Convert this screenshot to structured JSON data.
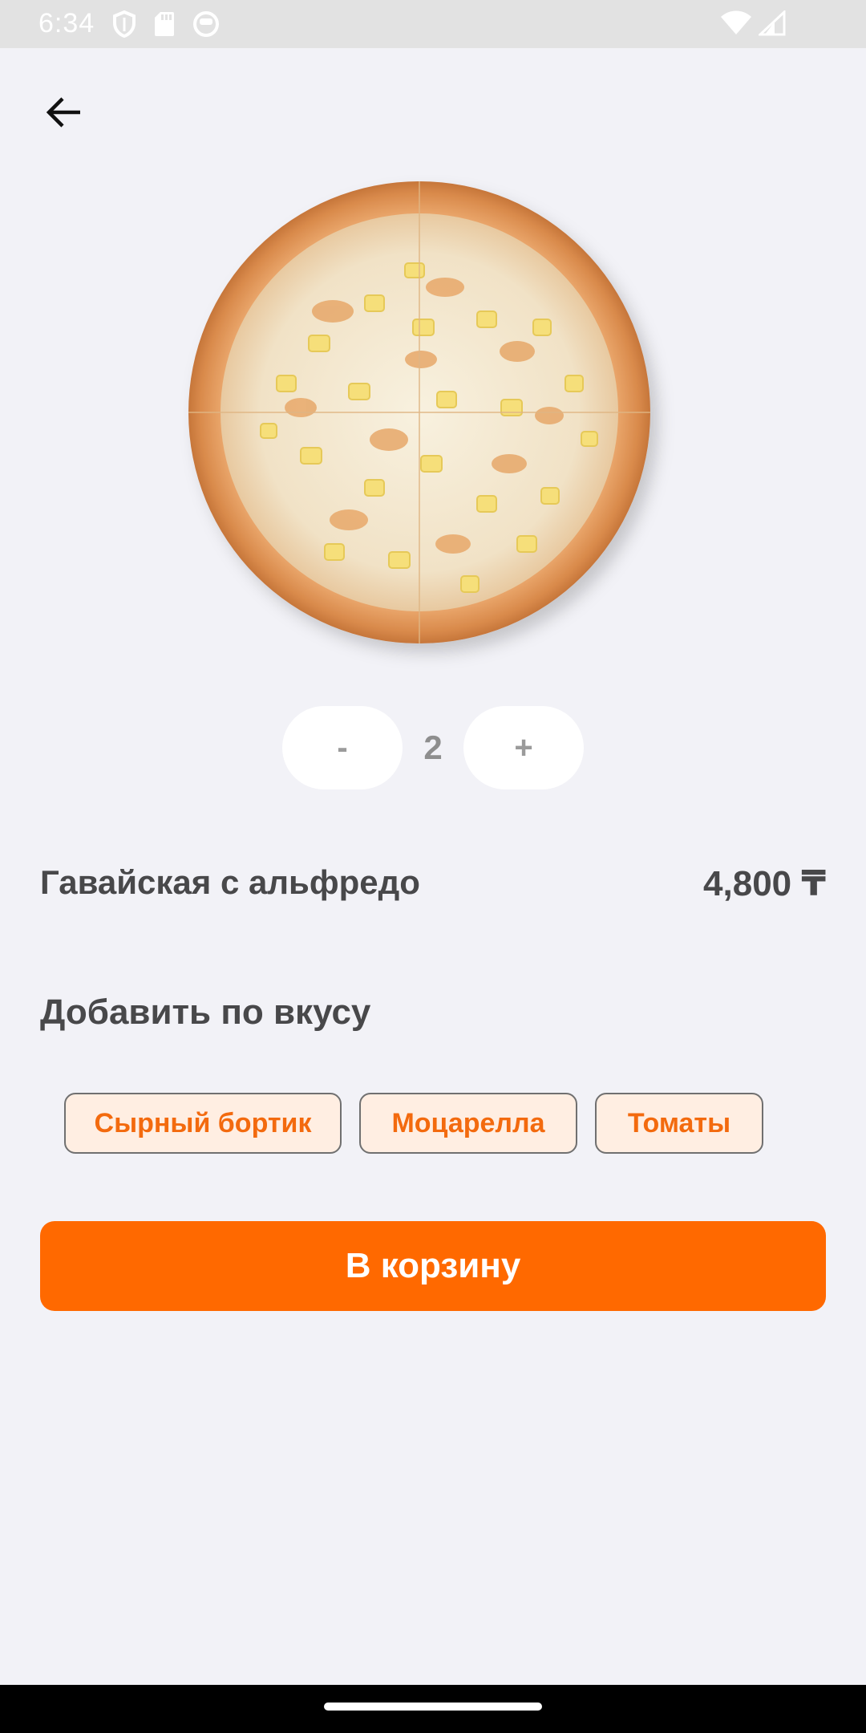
{
  "status_bar": {
    "time": "6:34",
    "left_icons": [
      "shield-icon",
      "sd-card-icon",
      "face-icon"
    ],
    "right_icons": [
      "wifi-icon",
      "signal-icon"
    ]
  },
  "header": {
    "back_icon": "arrow-left-icon"
  },
  "product": {
    "image": "pizza-image",
    "quantity": "2",
    "decrement_label": "-",
    "increment_label": "+",
    "name": "Гавайская с альфредо",
    "price": "4,800 ₸"
  },
  "toppings": {
    "title": "Добавить по вкусу",
    "items": [
      {
        "label": "Сырный бортик"
      },
      {
        "label": "Моцарелла"
      },
      {
        "label": "Томаты"
      }
    ]
  },
  "actions": {
    "add_to_cart_label": "В корзину"
  },
  "colors": {
    "accent": "#FF6900",
    "background": "#F2F2F7",
    "chip_bg": "#FFEEE2",
    "chip_text": "#F36A0E",
    "text_dark": "#48484A"
  }
}
